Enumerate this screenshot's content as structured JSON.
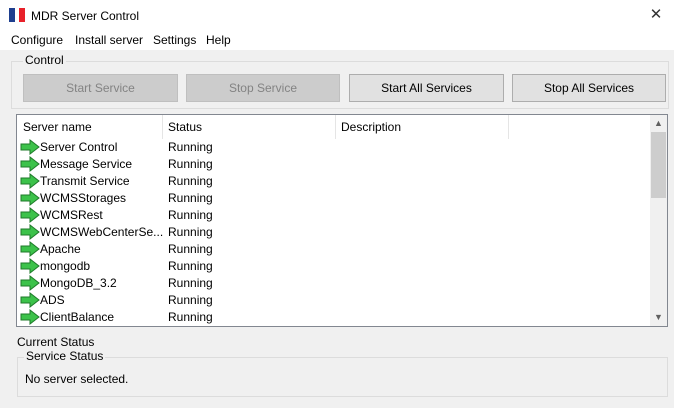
{
  "window": {
    "title": "MDR Server Control",
    "icon": "app-flag-icon",
    "close_glyph": "✕"
  },
  "menu": [
    "Configure",
    "Install server",
    "Settings",
    "Help"
  ],
  "control": {
    "label": "Control",
    "buttons": [
      {
        "label": "Start Service",
        "enabled": false
      },
      {
        "label": "Stop Service",
        "enabled": false
      },
      {
        "label": "Start All Services",
        "enabled": true
      },
      {
        "label": "Stop All Services",
        "enabled": true
      }
    ]
  },
  "services_table": {
    "columns": [
      "Server name",
      "Status",
      "Description"
    ],
    "row_icon": "green-arrow-icon",
    "rows": [
      {
        "name": "Server Control",
        "status": "Running",
        "description": ""
      },
      {
        "name": "Message Service",
        "status": "Running",
        "description": ""
      },
      {
        "name": "Transmit Service",
        "status": "Running",
        "description": ""
      },
      {
        "name": "WCMSStorages",
        "status": "Running",
        "description": ""
      },
      {
        "name": "WCMSRest",
        "status": "Running",
        "description": ""
      },
      {
        "name": "WCMSWebCenterSe...",
        "status": "Running",
        "description": ""
      },
      {
        "name": "Apache",
        "status": "Running",
        "description": ""
      },
      {
        "name": "mongodb",
        "status": "Running",
        "description": ""
      },
      {
        "name": "MongoDB_3.2",
        "status": "Running",
        "description": ""
      },
      {
        "name": "ADS",
        "status": "Running",
        "description": ""
      },
      {
        "name": "ClientBalance",
        "status": "Running",
        "description": ""
      }
    ]
  },
  "current_status": {
    "label": "Current Status",
    "service_status_label": "Service Status",
    "message": "No server selected."
  },
  "colors": {
    "row_icon_green": "#3cc24a",
    "disabled_button_bg": "#cccccc",
    "flag_red": "#e8212a",
    "flag_blue": "#1e3f8f"
  }
}
